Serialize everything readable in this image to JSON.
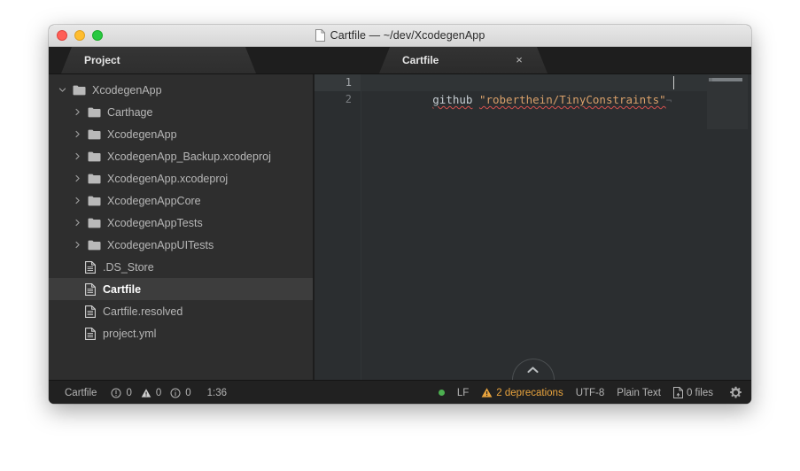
{
  "window": {
    "title": "Cartfile — ~/dev/XcodegenApp",
    "title_icon": "document-icon",
    "traffic": {
      "close": "close",
      "minimize": "minimize",
      "maximize": "maximize"
    }
  },
  "tabs": {
    "project": {
      "label": "Project"
    },
    "editor": {
      "label": "Cartfile",
      "close": "×"
    }
  },
  "sidebar": {
    "items": [
      {
        "label": "XcodegenApp",
        "icon": "folder-icon",
        "twisty": "chevron-down",
        "level": 0,
        "selected": false
      },
      {
        "label": "Carthage",
        "icon": "folder-icon",
        "twisty": "chevron-right",
        "level": 1,
        "selected": false
      },
      {
        "label": "XcodegenApp",
        "icon": "folder-icon",
        "twisty": "chevron-right",
        "level": 1,
        "selected": false
      },
      {
        "label": "XcodegenApp_Backup.xcodeproj",
        "icon": "folder-icon",
        "twisty": "chevron-right",
        "level": 1,
        "selected": false
      },
      {
        "label": "XcodegenApp.xcodeproj",
        "icon": "folder-icon",
        "twisty": "chevron-right",
        "level": 1,
        "selected": false
      },
      {
        "label": "XcodegenAppCore",
        "icon": "folder-icon",
        "twisty": "chevron-right",
        "level": 1,
        "selected": false
      },
      {
        "label": "XcodegenAppTests",
        "icon": "folder-icon",
        "twisty": "chevron-right",
        "level": 1,
        "selected": false
      },
      {
        "label": "XcodegenAppUITests",
        "icon": "folder-icon",
        "twisty": "chevron-right",
        "level": 1,
        "selected": false
      },
      {
        "label": ".DS_Store",
        "icon": "file-icon",
        "twisty": "",
        "level": 2,
        "selected": false
      },
      {
        "label": "Cartfile",
        "icon": "file-icon",
        "twisty": "",
        "level": 2,
        "selected": true
      },
      {
        "label": "Cartfile.resolved",
        "icon": "file-icon",
        "twisty": "",
        "level": 2,
        "selected": false
      },
      {
        "label": "project.yml",
        "icon": "file-icon",
        "twisty": "",
        "level": 2,
        "selected": false
      }
    ]
  },
  "editor": {
    "gutter": [
      "1",
      "2"
    ],
    "line1": {
      "keyword": "github",
      "space": " ",
      "string": "\"roberthein/TinyConstraints\"",
      "eol": "¬"
    },
    "scroll_up_button": "chevron-up-icon"
  },
  "statusbar": {
    "file": "Cartfile",
    "errors": "0",
    "warnings": "0",
    "infos": "0",
    "caret": "1:36",
    "line_ending": "LF",
    "deprecations": "2 deprecations",
    "encoding": "UTF-8",
    "filetype": "Plain Text",
    "files": "0 files",
    "settings_icon": "gear-icon",
    "warn_color": "#e8a33d",
    "ok_color": "#4caf50"
  }
}
